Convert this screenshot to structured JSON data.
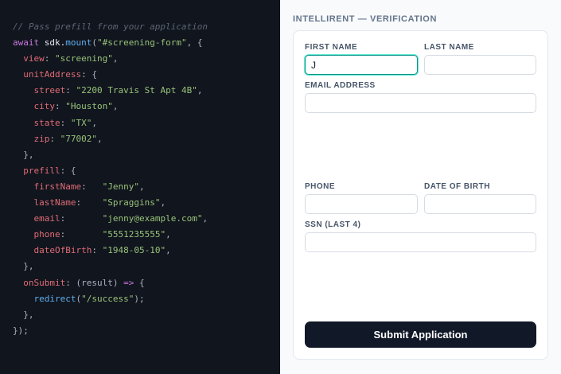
{
  "code": {
    "lines": [
      [
        {
          "t": "// Pass prefill from your application",
          "c": "comment"
        }
      ],
      [
        {
          "t": "await",
          "c": "keyword"
        },
        {
          "t": " sdk.",
          "c": "ident"
        },
        {
          "t": "mount",
          "c": "func"
        },
        {
          "t": "(",
          "c": "punc"
        },
        {
          "t": "\"#screening-form\"",
          "c": "str"
        },
        {
          "t": ", {",
          "c": "punc"
        }
      ],
      [
        {
          "t": "  ",
          "c": "punc"
        },
        {
          "t": "view",
          "c": "key"
        },
        {
          "t": ": ",
          "c": "punc"
        },
        {
          "t": "\"screening\"",
          "c": "str"
        },
        {
          "t": ",",
          "c": "punc"
        }
      ],
      [
        {
          "t": "  ",
          "c": "punc"
        },
        {
          "t": "unitAddress",
          "c": "key"
        },
        {
          "t": ": {",
          "c": "punc"
        }
      ],
      [
        {
          "t": "    ",
          "c": "punc"
        },
        {
          "t": "street",
          "c": "key"
        },
        {
          "t": ": ",
          "c": "punc"
        },
        {
          "t": "\"2200 Travis St Apt 4B\"",
          "c": "str"
        },
        {
          "t": ",",
          "c": "punc"
        }
      ],
      [
        {
          "t": "    ",
          "c": "punc"
        },
        {
          "t": "city",
          "c": "key"
        },
        {
          "t": ": ",
          "c": "punc"
        },
        {
          "t": "\"Houston\"",
          "c": "str"
        },
        {
          "t": ",",
          "c": "punc"
        }
      ],
      [
        {
          "t": "    ",
          "c": "punc"
        },
        {
          "t": "state",
          "c": "key"
        },
        {
          "t": ": ",
          "c": "punc"
        },
        {
          "t": "\"TX\"",
          "c": "str"
        },
        {
          "t": ",",
          "c": "punc"
        }
      ],
      [
        {
          "t": "    ",
          "c": "punc"
        },
        {
          "t": "zip",
          "c": "key"
        },
        {
          "t": ": ",
          "c": "punc"
        },
        {
          "t": "\"77002\"",
          "c": "str"
        },
        {
          "t": ",",
          "c": "punc"
        }
      ],
      [
        {
          "t": "  },",
          "c": "punc"
        }
      ],
      [
        {
          "t": "  ",
          "c": "punc"
        },
        {
          "t": "prefill",
          "c": "key"
        },
        {
          "t": ": {",
          "c": "punc"
        }
      ],
      [
        {
          "t": "    ",
          "c": "punc"
        },
        {
          "t": "firstName",
          "c": "key"
        },
        {
          "t": ":   ",
          "c": "punc"
        },
        {
          "t": "\"Jenny\"",
          "c": "str"
        },
        {
          "t": ",",
          "c": "punc"
        }
      ],
      [
        {
          "t": "    ",
          "c": "punc"
        },
        {
          "t": "lastName",
          "c": "key"
        },
        {
          "t": ":    ",
          "c": "punc"
        },
        {
          "t": "\"Spraggins\"",
          "c": "str"
        },
        {
          "t": ",",
          "c": "punc"
        }
      ],
      [
        {
          "t": "    ",
          "c": "punc"
        },
        {
          "t": "email",
          "c": "key"
        },
        {
          "t": ":       ",
          "c": "punc"
        },
        {
          "t": "\"jenny@example.com\"",
          "c": "str"
        },
        {
          "t": ",",
          "c": "punc"
        }
      ],
      [
        {
          "t": "    ",
          "c": "punc"
        },
        {
          "t": "phone",
          "c": "key"
        },
        {
          "t": ":       ",
          "c": "punc"
        },
        {
          "t": "\"5551235555\"",
          "c": "str"
        },
        {
          "t": ",",
          "c": "punc"
        }
      ],
      [
        {
          "t": "    ",
          "c": "punc"
        },
        {
          "t": "dateOfBirth",
          "c": "key"
        },
        {
          "t": ": ",
          "c": "punc"
        },
        {
          "t": "\"1948-05-10\"",
          "c": "str"
        },
        {
          "t": ",",
          "c": "punc"
        }
      ],
      [
        {
          "t": "  },",
          "c": "punc"
        }
      ],
      [
        {
          "t": "  ",
          "c": "punc"
        },
        {
          "t": "onSubmit",
          "c": "key"
        },
        {
          "t": ": (result) ",
          "c": "punc"
        },
        {
          "t": "=>",
          "c": "keyword"
        },
        {
          "t": " {",
          "c": "punc"
        }
      ],
      [
        {
          "t": "    ",
          "c": "punc"
        },
        {
          "t": "redirect",
          "c": "func"
        },
        {
          "t": "(",
          "c": "punc"
        },
        {
          "t": "\"/success\"",
          "c": "str"
        },
        {
          "t": ");",
          "c": "punc"
        }
      ],
      [
        {
          "t": "  },",
          "c": "punc"
        }
      ],
      [
        {
          "t": "});",
          "c": "punc"
        }
      ]
    ]
  },
  "form": {
    "title": "INTELLIRENT — VERIFICATION",
    "first_name": {
      "label": "FIRST NAME",
      "value": "J",
      "placeholder": ""
    },
    "last_name": {
      "label": "LAST NAME",
      "value": "",
      "placeholder": ""
    },
    "email": {
      "label": "EMAIL ADDRESS",
      "value": "",
      "placeholder": ""
    },
    "phone": {
      "label": "PHONE",
      "value": "",
      "placeholder": ""
    },
    "dob": {
      "label": "DATE OF BIRTH",
      "value": "",
      "placeholder": ""
    },
    "ssn": {
      "label": "SSN (LAST 4)",
      "value": "",
      "placeholder": ""
    },
    "submit_label": "Submit Application"
  },
  "colors": {
    "code_background": "#11151e",
    "accent_focus": "#0d9488",
    "button_background": "#111827"
  }
}
